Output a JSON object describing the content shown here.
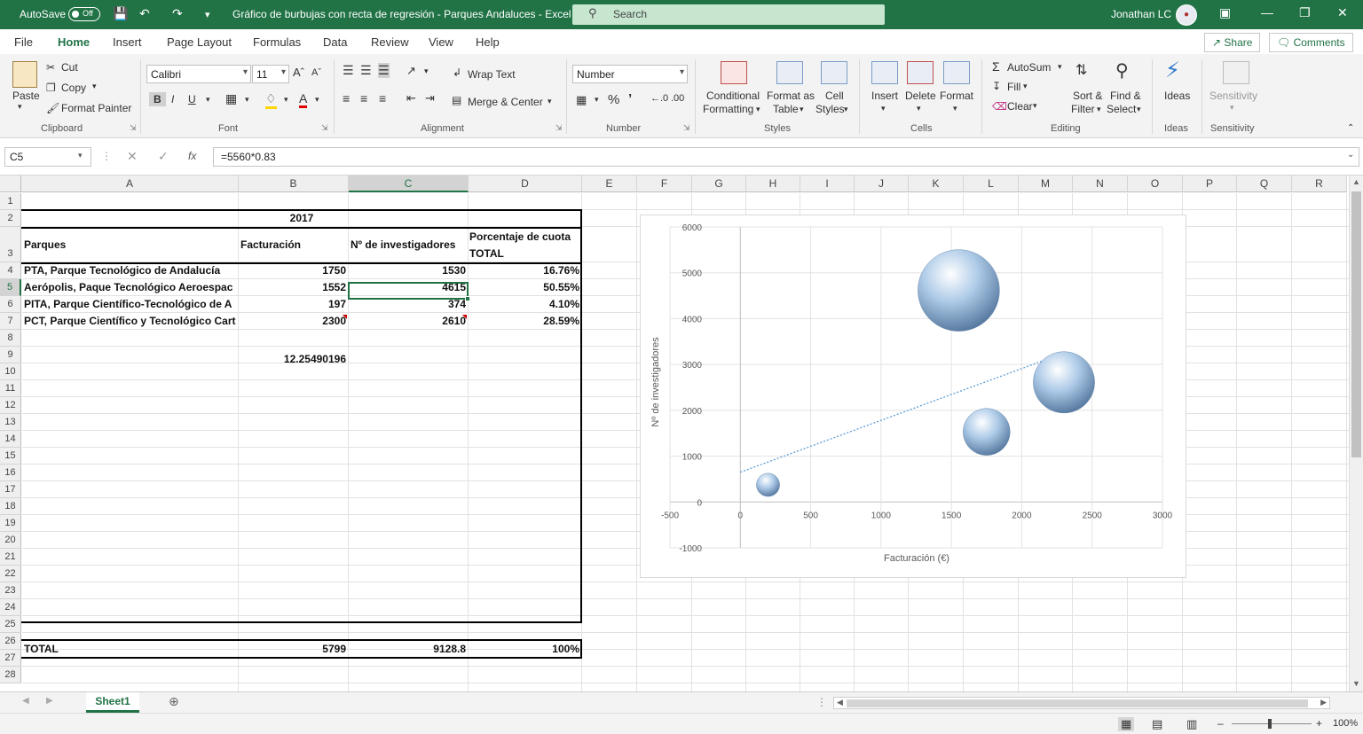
{
  "titlebar": {
    "autosave": "AutoSave",
    "autosave_state": "Off",
    "doc_title": "Gráfico de burbujas con recta de regresión - Parques Andaluces  -  Excel",
    "search_placeholder": "Search",
    "user": "Jonathan LC"
  },
  "ribbon_tabs": [
    "File",
    "Home",
    "Insert",
    "Page Layout",
    "Formulas",
    "Data",
    "Review",
    "View",
    "Help"
  ],
  "active_tab": "Home",
  "share_label": "Share",
  "comments_label": "Comments",
  "ribbon": {
    "paste": "Paste",
    "cut": "Cut",
    "copy": "Copy",
    "format_painter": "Format Painter",
    "clipboard": "Clipboard",
    "font_name": "Calibri",
    "font_size": "11",
    "font": "Font",
    "wrap_text": "Wrap Text",
    "merge_center": "Merge & Center",
    "alignment": "Alignment",
    "number_format": "Number",
    "number": "Number",
    "conditional_formatting_1": "Conditional",
    "conditional_formatting_2": "Formatting",
    "format_as_table_1": "Format as",
    "format_as_table_2": "Table",
    "cell_styles_1": "Cell",
    "cell_styles_2": "Styles",
    "styles": "Styles",
    "insert": "Insert",
    "delete": "Delete",
    "format": "Format",
    "cells": "Cells",
    "autosum": "AutoSum",
    "fill": "Fill",
    "clear": "Clear",
    "sort_filter_1": "Sort &",
    "sort_filter_2": "Filter",
    "find_select_1": "Find &",
    "find_select_2": "Select",
    "editing": "Editing",
    "ideas": "Ideas",
    "ideas_group": "Ideas",
    "sensitivity": "Sensitivity",
    "sensitivity_group": "Sensitivity"
  },
  "formula_bar": {
    "name_box": "C5",
    "formula": "=5560*0.83",
    "fx": "fx"
  },
  "columns": [
    "A",
    "B",
    "C",
    "D",
    "E",
    "F",
    "G",
    "H",
    "I",
    "J",
    "K",
    "L",
    "M",
    "N",
    "O",
    "P",
    "Q",
    "R"
  ],
  "rows": [
    "1",
    "2",
    "3",
    "4",
    "5",
    "6",
    "7",
    "8",
    "9",
    "10",
    "11",
    "12",
    "13",
    "14",
    "15",
    "16",
    "17",
    "18",
    "19",
    "20",
    "21",
    "22",
    "23",
    "24",
    "25",
    "26",
    "27",
    "28"
  ],
  "table": {
    "year": "2017",
    "headers": {
      "a": "Parques",
      "b": "Facturación",
      "c": "Nº de investigadores",
      "d1": "Porcentaje de cuota",
      "d2": "TOTAL"
    },
    "rows": [
      {
        "a": "PTA, Parque Tecnológico de Andalucía",
        "b": "1750",
        "c": "1530",
        "d": "16.76%"
      },
      {
        "a": "Aerópolis, Paque Tecnológico Aeroespac",
        "b": "1552",
        "c": "4615",
        "d": "50.55%"
      },
      {
        "a": "PITA, Parque Científico-Tecnológico de A",
        "b": "197",
        "c": "374",
        "d": "4.10%"
      },
      {
        "a": "PCT, Parque Científico y Tecnológico Cart",
        "b": "2300",
        "c": "2610",
        "d": "28.59%"
      }
    ],
    "b9": "12.25490196",
    "total": {
      "a": "TOTAL",
      "b": "5799",
      "c": "9128.8",
      "d": "100%"
    }
  },
  "chart_data": {
    "type": "bubble",
    "title": "",
    "xlabel": "Facturación (€)",
    "ylabel": "Nº de investigadores",
    "xlim": [
      -500,
      3000
    ],
    "ylim": [
      -1000,
      6000
    ],
    "xticks": [
      -500,
      0,
      500,
      1000,
      1500,
      2000,
      2500,
      3000
    ],
    "yticks": [
      -1000,
      0,
      1000,
      2000,
      3000,
      4000,
      5000,
      6000
    ],
    "grid": true,
    "points": [
      {
        "x": 1750,
        "y": 1530,
        "size": 16.76
      },
      {
        "x": 1552,
        "y": 4615,
        "size": 50.55
      },
      {
        "x": 197,
        "y": 374,
        "size": 4.1
      },
      {
        "x": 2300,
        "y": 2610,
        "size": 28.59
      }
    ],
    "trendline": {
      "type": "linear",
      "color": "#5b9bd5",
      "x_start": 0,
      "y_start": 650,
      "x_end": 2300,
      "y_end": 3250
    },
    "bubble_color": "#9dc3e6"
  },
  "sheet_tab": "Sheet1",
  "zoom": "100%"
}
